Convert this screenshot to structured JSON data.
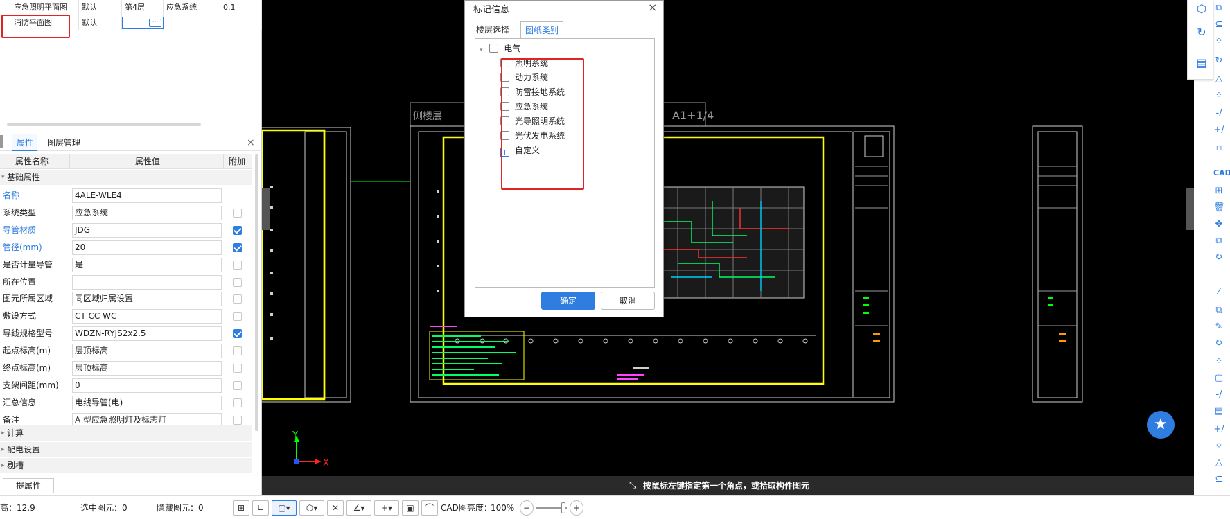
{
  "floor_list": {
    "rows": [
      {
        "name": "应急照明平面图",
        "group": "默认",
        "floor": "第4层",
        "system": "应急系统",
        "value": "0.1"
      },
      {
        "name": "消防平面图",
        "group": "默认",
        "floor": "",
        "system": "",
        "value": ""
      }
    ],
    "more_label": "···"
  },
  "properties": {
    "tab_attr": "属性",
    "tab_layer": "图层管理",
    "close": "×",
    "col_name": "属性名称",
    "col_value": "属性值",
    "col_extra": "附加",
    "section_basic": "基础属性",
    "rows": [
      {
        "name": "名称",
        "value": "4ALE-WLE4",
        "blue": true,
        "cb": null
      },
      {
        "name": "系统类型",
        "value": "应急系统",
        "blue": false,
        "cb": false
      },
      {
        "name": "导管材质",
        "value": "JDG",
        "blue": true,
        "cb": true
      },
      {
        "name": "管径(mm)",
        "value": "20",
        "blue": true,
        "cb": true
      },
      {
        "name": "是否计量导管",
        "value": "是",
        "blue": false,
        "cb": false
      },
      {
        "name": "所在位置",
        "value": "",
        "blue": false,
        "cb": false
      },
      {
        "name": "图元所属区域",
        "value": "同区域归属设置",
        "blue": false,
        "cb": false
      },
      {
        "name": "敷设方式",
        "value": "CT CC WC",
        "blue": false,
        "cb": false
      },
      {
        "name": "导线规格型号",
        "value": "WDZN-RYJS2x2.5",
        "blue": false,
        "cb": true
      },
      {
        "name": "起点标高(m)",
        "value": "层顶标高",
        "blue": false,
        "cb": false
      },
      {
        "name": "终点标高(m)",
        "value": "层顶标高",
        "blue": false,
        "cb": false
      },
      {
        "name": "支架间距(mm)",
        "value": "0",
        "blue": false,
        "cb": false
      },
      {
        "name": "汇总信息",
        "value": "电线导管(电)",
        "blue": false,
        "cb": false
      },
      {
        "name": "备注",
        "value": "A 型应急照明灯及标志灯",
        "blue": false,
        "cb": false
      }
    ],
    "section_calc": "计算",
    "section_power": "配电设置",
    "section_slot": "剔槽",
    "extract_button": "提属性"
  },
  "dialog": {
    "title": "标记信息",
    "close": "×",
    "tab_floor": "楼层选择",
    "tab_category": "图纸类别",
    "root": "电气",
    "items": [
      "照明系统",
      "动力系统",
      "防雷接地系统",
      "应急系统",
      "光导照明系统",
      "光伏发电系统"
    ],
    "custom": "自定义",
    "ok": "确定",
    "cancel": "取消"
  },
  "cad": {
    "title_fragment": "A1+1/4",
    "left_title_fragment": "侧楼层",
    "axis_x": "X",
    "axis_y": "Y"
  },
  "command_hint": "按鼠标左键指定第一个角点，或拾取构件图元",
  "toolbar": {
    "cad_label": "CAD"
  },
  "status": {
    "height": "高：12.9",
    "selected": "选中图元：0",
    "hidden": "隐藏图元：0",
    "brightness_label": "CAD图亮度：",
    "brightness_value": "100%"
  },
  "colors": {
    "accent": "#2f7de1",
    "red_box": "#e02424",
    "cad_yellow": "#ffff00",
    "cad_bg": "#000000"
  }
}
